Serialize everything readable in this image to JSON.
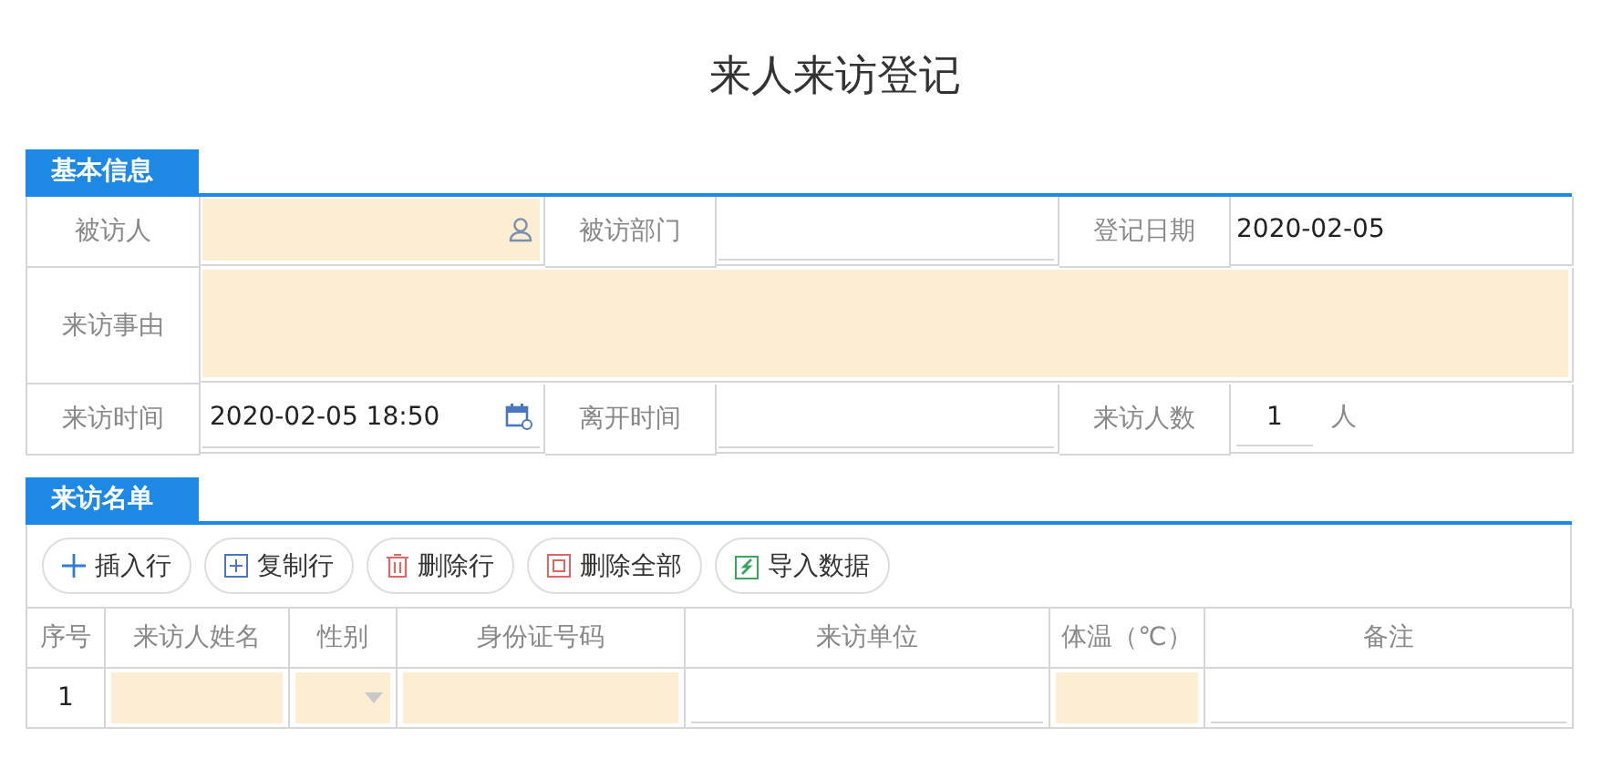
{
  "title": "来人来访登记",
  "basic_info": {
    "heading": "基本信息",
    "rows": [
      {
        "fields": [
          {
            "label": "被访人",
            "kind": "person",
            "required": true
          },
          {
            "label": "被访部门",
            "kind": "text",
            "required": false
          },
          {
            "label": "登记日期",
            "kind": "plain",
            "required": false,
            "value": "2020-02-05"
          }
        ]
      },
      {
        "fields": [
          {
            "label": "来访事由",
            "kind": "textarea",
            "required": true
          }
        ]
      },
      {
        "fields": [
          {
            "label": "来访时间",
            "kind": "datetime",
            "required": false,
            "value": "2020-02-05 18:50"
          },
          {
            "label": "离开时间",
            "kind": "text",
            "required": false
          },
          {
            "label": "来访人数",
            "kind": "count",
            "required": false,
            "value": "1",
            "unit": "人"
          }
        ]
      }
    ]
  },
  "visitor_list": {
    "heading": "来访名单",
    "toolbar": [
      {
        "label": "插入行",
        "kind": "insert"
      },
      {
        "label": "复制行",
        "kind": "copy"
      },
      {
        "label": "删除行",
        "kind": "delete"
      },
      {
        "label": "删除全部",
        "kind": "delete-all"
      },
      {
        "label": "导入数据",
        "kind": "import"
      }
    ],
    "columns": [
      "序号",
      "来访人姓名",
      "性别",
      "身份证号码",
      "来访单位",
      "体温（℃）",
      "备注"
    ],
    "rows": [
      {
        "cells": [
          {
            "kind": "index",
            "value": "1"
          },
          {
            "kind": "text",
            "required": true
          },
          {
            "kind": "select",
            "required": true
          },
          {
            "kind": "text",
            "required": true
          },
          {
            "kind": "text",
            "required": false
          },
          {
            "kind": "text",
            "required": true
          },
          {
            "kind": "text",
            "required": false
          }
        ]
      }
    ]
  }
}
